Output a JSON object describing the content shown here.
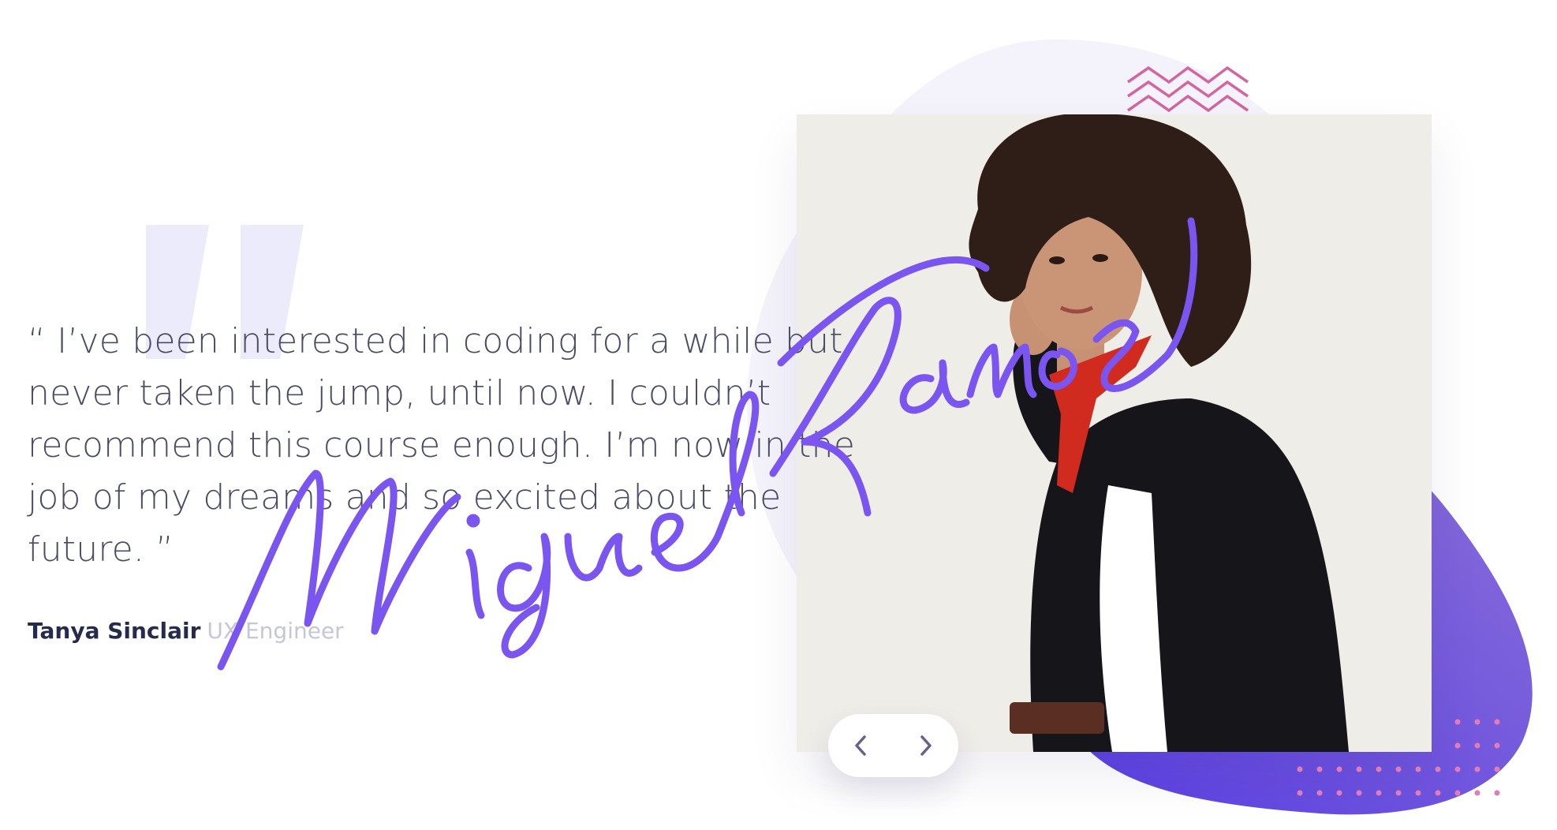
{
  "testimonial": {
    "quote": "“ I’ve been interested in coding for a while but never taken the jump, until now. I couldn’t recommend this course enough. I’m now in the job of my dreams and so excited about the future. ”",
    "author_name": "Tanya Sinclair",
    "author_role": "UX Engineer"
  },
  "signature": {
    "text": "Miguel Ramos"
  },
  "navigation": {
    "prev_icon": "chevron-left-icon",
    "next_icon": "chevron-right-icon"
  },
  "colors": {
    "accent_purple": "#6b4fe0",
    "signature_purple": "#7a55f0",
    "zigzag_pink": "#d4659e",
    "dot_pink": "#e27cb5",
    "text_dark": "#242b4c",
    "text_body": "#4a4c66",
    "text_muted": "#c5c6d6",
    "blob_light": "#f4f3fb"
  }
}
